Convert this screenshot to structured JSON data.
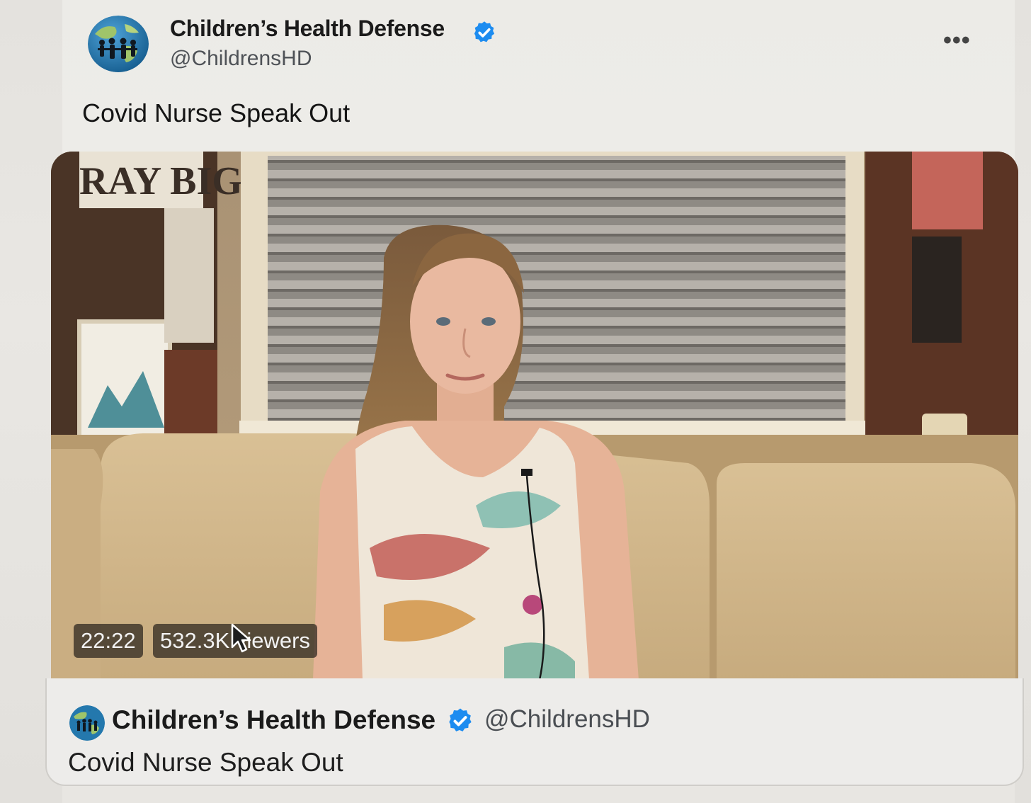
{
  "post": {
    "author_name": "Children’s Health Defense",
    "handle": "@ChildrensHD",
    "text": "Covid Nurse Speak Out",
    "more_label": "•••",
    "verified": true
  },
  "video": {
    "duration": "22:22",
    "viewers": "532.3K viewers",
    "background_sign": "RAY BIG"
  },
  "card": {
    "author_name": "Children’s Health Defense",
    "handle": "@ChildrensHD",
    "text": "Covid Nurse Speak Out"
  },
  "colors": {
    "verified_blue": "#1d8cf0",
    "text_primary": "#151515",
    "text_secondary": "#4e5257"
  }
}
